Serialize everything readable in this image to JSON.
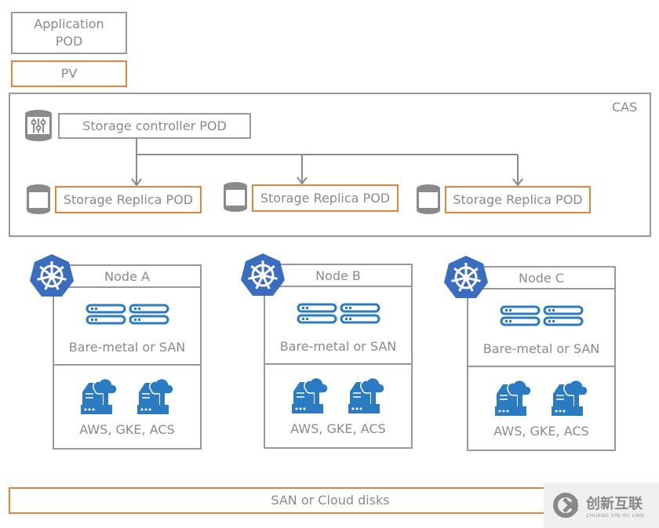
{
  "legend": {
    "application_pod": "Application POD",
    "pv": "PV"
  },
  "cas": {
    "label": "CAS",
    "controller": "Storage controller POD",
    "replicas": [
      "Storage Replica POD",
      "Storage Replica POD",
      "Storage Replica POD"
    ]
  },
  "nodes": [
    {
      "name": "Node A",
      "storage": "Bare-metal or SAN",
      "cloud": "AWS, GKE, ACS"
    },
    {
      "name": "Node B",
      "storage": "Bare-metal or SAN",
      "cloud": "AWS, GKE, ACS"
    },
    {
      "name": "Node C",
      "storage": "Bare-metal or SAN",
      "cloud": "AWS, GKE, ACS"
    }
  ],
  "bottom": {
    "label": "SAN or Cloud disks"
  },
  "watermark": {
    "text": "创新互联",
    "sub": "CHUANG XIN HU LIAN"
  },
  "colors": {
    "pv_border": "#e8833a",
    "box_border": "#999999",
    "kubernetes": "#3a6cc0",
    "server": "#2b7bc2"
  },
  "icons": {
    "controller": "storage-controller-icon",
    "replica": "cylinder-disk-icon",
    "node": "kubernetes-icon",
    "storage": "server-rack-icon",
    "cloud": "cloud-server-icon"
  }
}
